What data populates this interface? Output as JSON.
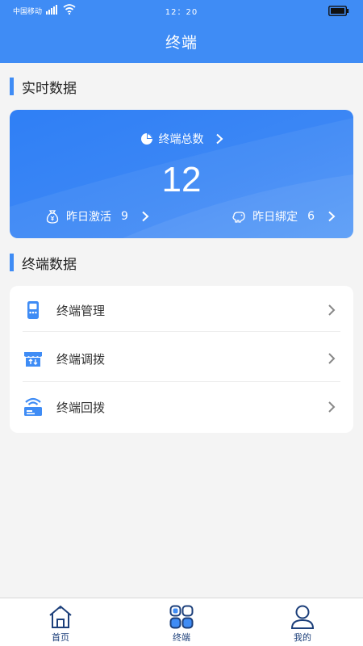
{
  "status_bar": {
    "carrier": "中国移动",
    "time": "12：20"
  },
  "header": {
    "title": "终端"
  },
  "realtime": {
    "section_title": "实时数据",
    "total_label": "终端总数",
    "total_value": "12",
    "activated_label": "昨日激活",
    "activated_value": "9",
    "bound_label": "昨日綁定",
    "bound_value": "6"
  },
  "terminal_data": {
    "section_title": "终端数据",
    "items": [
      {
        "label": "终端管理",
        "icon": "device-icon"
      },
      {
        "label": "终端调拨",
        "icon": "store-transfer-icon"
      },
      {
        "label": "终端回拨",
        "icon": "terminal-return-icon"
      }
    ]
  },
  "bottom_nav": {
    "items": [
      {
        "label": "首页",
        "icon": "home-icon"
      },
      {
        "label": "终端",
        "icon": "terminal-grid-icon"
      },
      {
        "label": "我的",
        "icon": "user-icon"
      }
    ]
  },
  "colors": {
    "primary": "#3f8cf5",
    "nav_text": "#1c3f7a",
    "background": "#f4f4f4"
  }
}
